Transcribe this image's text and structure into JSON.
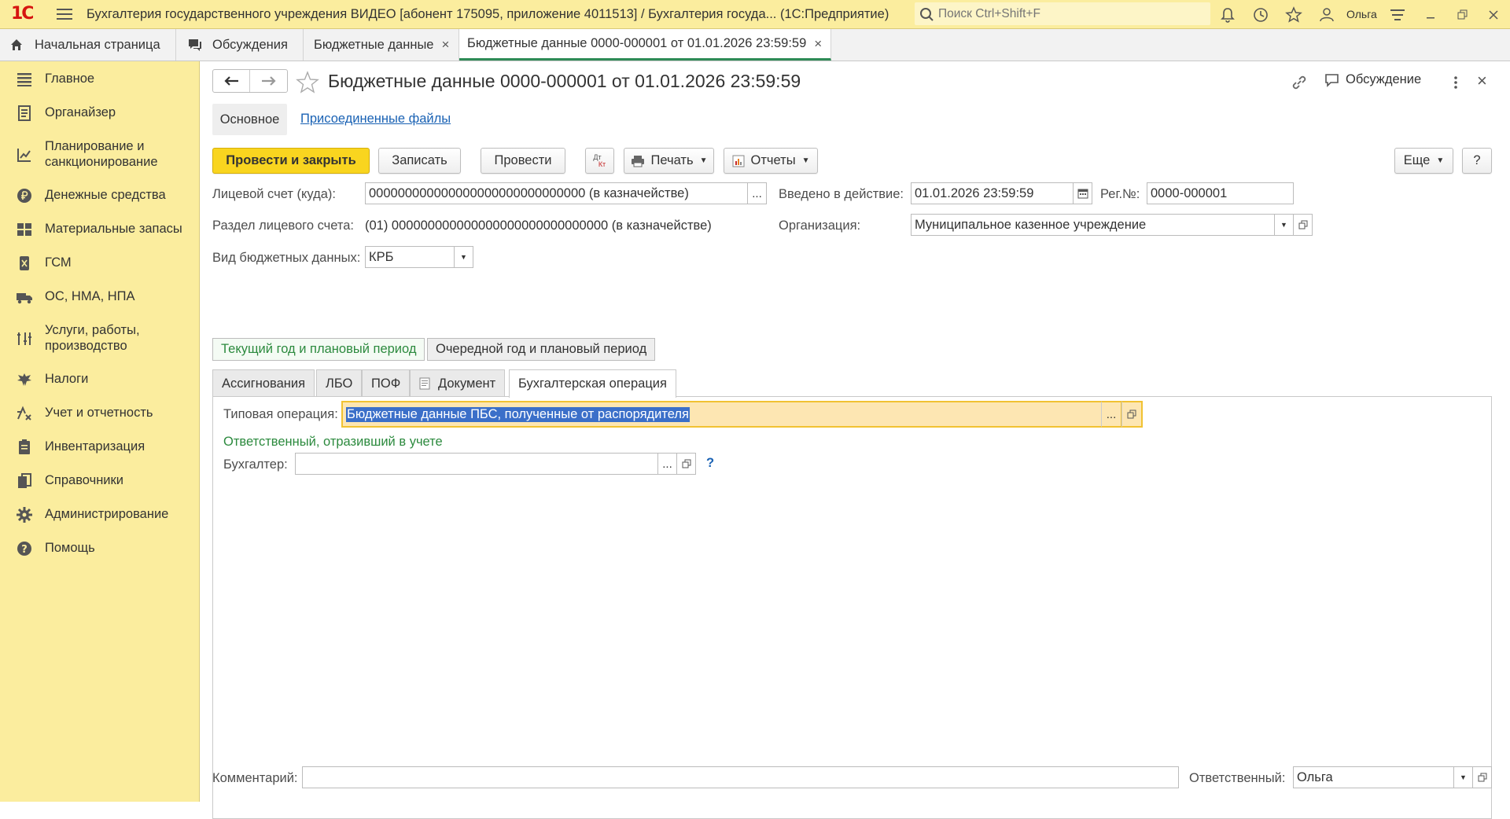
{
  "app": {
    "title": "Бухгалтерия государственного учреждения ВИДЕО [абонент 175095, приложение 4011513] / Бухгалтерия госуда...  (1С:Предприятие)",
    "logo_text": "1С",
    "search_placeholder": "Поиск Ctrl+Shift+F",
    "user": "Ольга"
  },
  "tabs": [
    {
      "label": "Начальная страница"
    },
    {
      "label": "Обсуждения"
    },
    {
      "label": "Бюджетные данные",
      "close": "×"
    },
    {
      "label": "Бюджетные данные 0000-000001 от 01.01.2026 23:59:59",
      "close": "×"
    }
  ],
  "sidebar": {
    "items": [
      {
        "label": "Главное",
        "icon": "list-icon"
      },
      {
        "label": "Органайзер",
        "icon": "notebook-icon"
      },
      {
        "label": "Планирование и санкционирование",
        "icon": "planning-icon"
      },
      {
        "label": "Денежные средства",
        "icon": "ruble-icon"
      },
      {
        "label": "Материальные запасы",
        "icon": "grid-icon"
      },
      {
        "label": "ГСМ",
        "icon": "fuel-icon"
      },
      {
        "label": "ОС, НМА, НПА",
        "icon": "truck-icon"
      },
      {
        "label": "Услуги, работы, производство",
        "icon": "tools-icon"
      },
      {
        "label": "Налоги",
        "icon": "eagle-icon"
      },
      {
        "label": "Учет и отчетность",
        "icon": "accounting-icon"
      },
      {
        "label": "Инвентаризация",
        "icon": "inventory-icon"
      },
      {
        "label": "Справочники",
        "icon": "books-icon"
      },
      {
        "label": "Администрирование",
        "icon": "gear-icon"
      },
      {
        "label": "Помощь",
        "icon": "help-icon"
      }
    ]
  },
  "document": {
    "title": "Бюджетные данные 0000-000001 от 01.01.2026 23:59:59",
    "discussion_label": "Обсуждение",
    "close": "×",
    "subtabs": {
      "main": "Основное",
      "files": "Присоединенные файлы"
    }
  },
  "toolbar": {
    "post_and_close": "Провести и закрыть",
    "save": "Записать",
    "post": "Провести",
    "dtkt_top": "Дт",
    "dtkt_bottom": "Кт",
    "print": "Печать",
    "reports": "Отчеты",
    "more": "Еще",
    "help": "?"
  },
  "form": {
    "account_label": "Лицевой счет (куда):",
    "account_value": "000000000000000000000000000000 (в казначействе)",
    "effective_label": "Введено в действие:",
    "effective_value": "01.01.2026 23:59:59",
    "reg_label": "Рег.№:",
    "reg_value": "0000-000001",
    "section_label": "Раздел лицевого счета:",
    "section_value": "(01) 000000000000000000000000000000 (в казначействе)",
    "org_label": "Организация:",
    "org_value": "Муниципальное казенное учреждение",
    "type_label": "Вид бюджетных данных:",
    "type_value": "КРБ",
    "dots": "..."
  },
  "periods": {
    "current": "Текущий год и плановый период",
    "next": "Очередной год и плановый период"
  },
  "form_tabs": [
    {
      "label": "Ассигнования"
    },
    {
      "label": "ЛБО"
    },
    {
      "label": "ПОФ"
    },
    {
      "label": "Документ"
    },
    {
      "label": "Бухгалтерская операция"
    }
  ],
  "operation": {
    "typical_label": "Типовая операция:",
    "typical_value": "Бюджетные данные ПБС, полученные от распорядителя",
    "responsible_header": "Ответственный, отразивший в учете",
    "accountant_label": "Бухгалтер:",
    "accountant_value": "",
    "help": "?"
  },
  "footer": {
    "comment_label": "Комментарий:",
    "comment_value": "",
    "responsible_label": "Ответственный:",
    "responsible_value": "Ольга"
  },
  "colors": {
    "topbar": "#fbed9e",
    "primary_button": "#f9d51f",
    "active_tab_underline": "#2e8b57",
    "link": "#1a62b4",
    "green_text": "#2c8a3e",
    "selected_field": "#fde6b2"
  }
}
